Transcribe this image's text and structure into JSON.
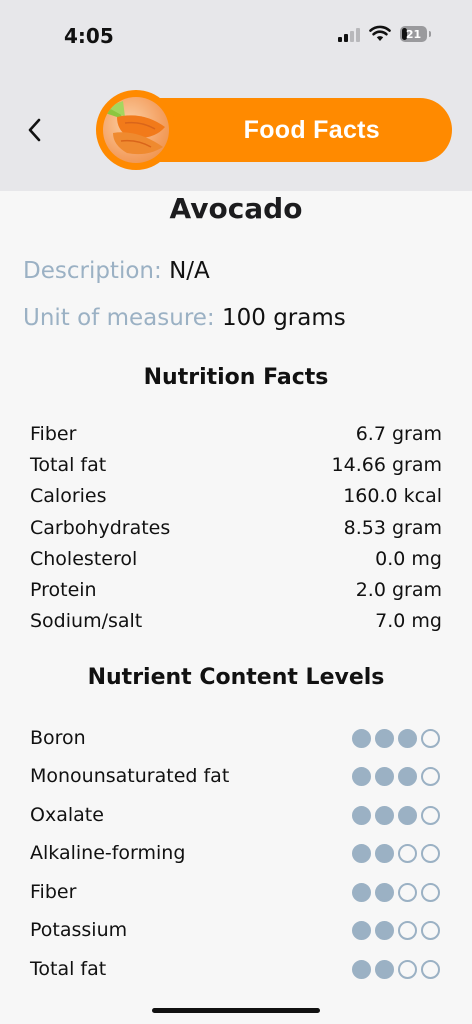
{
  "status": {
    "time": "4:05",
    "battery": "21"
  },
  "header": {
    "title": "Food Facts"
  },
  "food": {
    "name": "Avocado",
    "description_label": "Description:",
    "description_value": "N/A",
    "unit_label": "Unit of measure:",
    "unit_value": "100 grams"
  },
  "nutrition": {
    "title": "Nutrition Facts",
    "rows": [
      {
        "name": "Fiber",
        "value": "6.7 gram"
      },
      {
        "name": "Total fat",
        "value": "14.66 gram"
      },
      {
        "name": "Calories",
        "value": "160.0 kcal"
      },
      {
        "name": "Carbohydrates",
        "value": "8.53 gram"
      },
      {
        "name": "Cholesterol",
        "value": "0.0 mg"
      },
      {
        "name": "Protein",
        "value": "2.0 gram"
      },
      {
        "name": "Sodium/salt",
        "value": "7.0 mg"
      }
    ]
  },
  "levels": {
    "title": "Nutrient Content Levels",
    "max": 4,
    "dot_color": "#9bb1c4",
    "rows": [
      {
        "name": "Boron",
        "level": 3
      },
      {
        "name": "Monounsaturated fat",
        "level": 3
      },
      {
        "name": "Oxalate",
        "level": 3
      },
      {
        "name": "Alkaline-forming",
        "level": 2
      },
      {
        "name": "Fiber",
        "level": 2
      },
      {
        "name": "Potassium",
        "level": 2
      },
      {
        "name": "Total fat",
        "level": 2
      }
    ]
  },
  "colors": {
    "accent": "#ff8a00",
    "label": "#9bb1c4",
    "header_bg": "#e7e7ea"
  }
}
